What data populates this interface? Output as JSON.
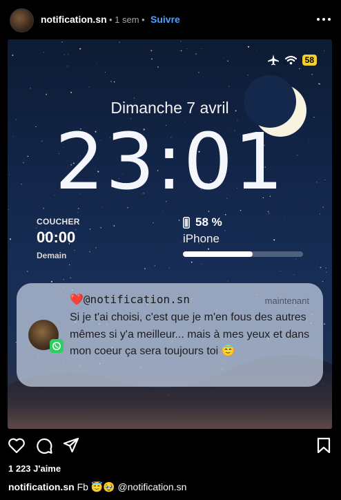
{
  "header": {
    "username": "notification.sn",
    "time_ago": "• 1 sem •",
    "follow_label": "Suivre"
  },
  "lockscreen": {
    "battery_level": "58",
    "date": "Dimanche 7 avril",
    "time": "23:01",
    "alarm": {
      "label": "COUCHER",
      "time": "00:00",
      "day": "Demain"
    },
    "battery_widget": {
      "percent_text": "58 %",
      "device": "iPhone",
      "level": 0.58
    },
    "notification": {
      "heart": "❤️",
      "sender": "@notification.sn",
      "timestamp": "maintenant",
      "message": "Si je t'ai choisi, c'est que je m'en fous des autres mêmes si y'a meilleur... mais à mes yeux et dans mon coeur ça sera toujours toi 😇"
    }
  },
  "actions": {
    "icons": [
      "heart-icon",
      "comment-icon",
      "share-icon",
      "bookmark-icon"
    ]
  },
  "likes": "1 223 J'aime",
  "caption": {
    "username": "notification.sn",
    "text": "Fb 😇🥹 @notification.sn"
  },
  "colors": {
    "follow": "#4aa3ff",
    "battery_badge": "#f5d02a",
    "whatsapp": "#2bd15e"
  }
}
